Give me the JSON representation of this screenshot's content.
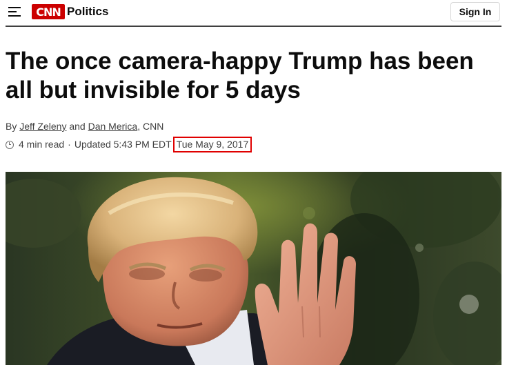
{
  "header": {
    "brand": "CNN",
    "section": "Politics",
    "sign_in_label": "Sign In",
    "menu_icon": "hamburger-menu-icon"
  },
  "article": {
    "headline": "The once camera-happy Trump has been all but invisible for 5 days",
    "byline": {
      "prefix": "By",
      "author1": "Jeff Zeleny",
      "conjunction": "and",
      "author2": "Dan Merica",
      "outlet": ", CNN"
    },
    "meta": {
      "read_time": "4 min read",
      "separator": "·",
      "updated": "Updated 5:43 PM EDT",
      "date": "Tue May 9, 2017"
    }
  },
  "colors": {
    "brand_red": "#cc0000",
    "highlight_box": "#e00000",
    "text": "#0c0c0c"
  }
}
